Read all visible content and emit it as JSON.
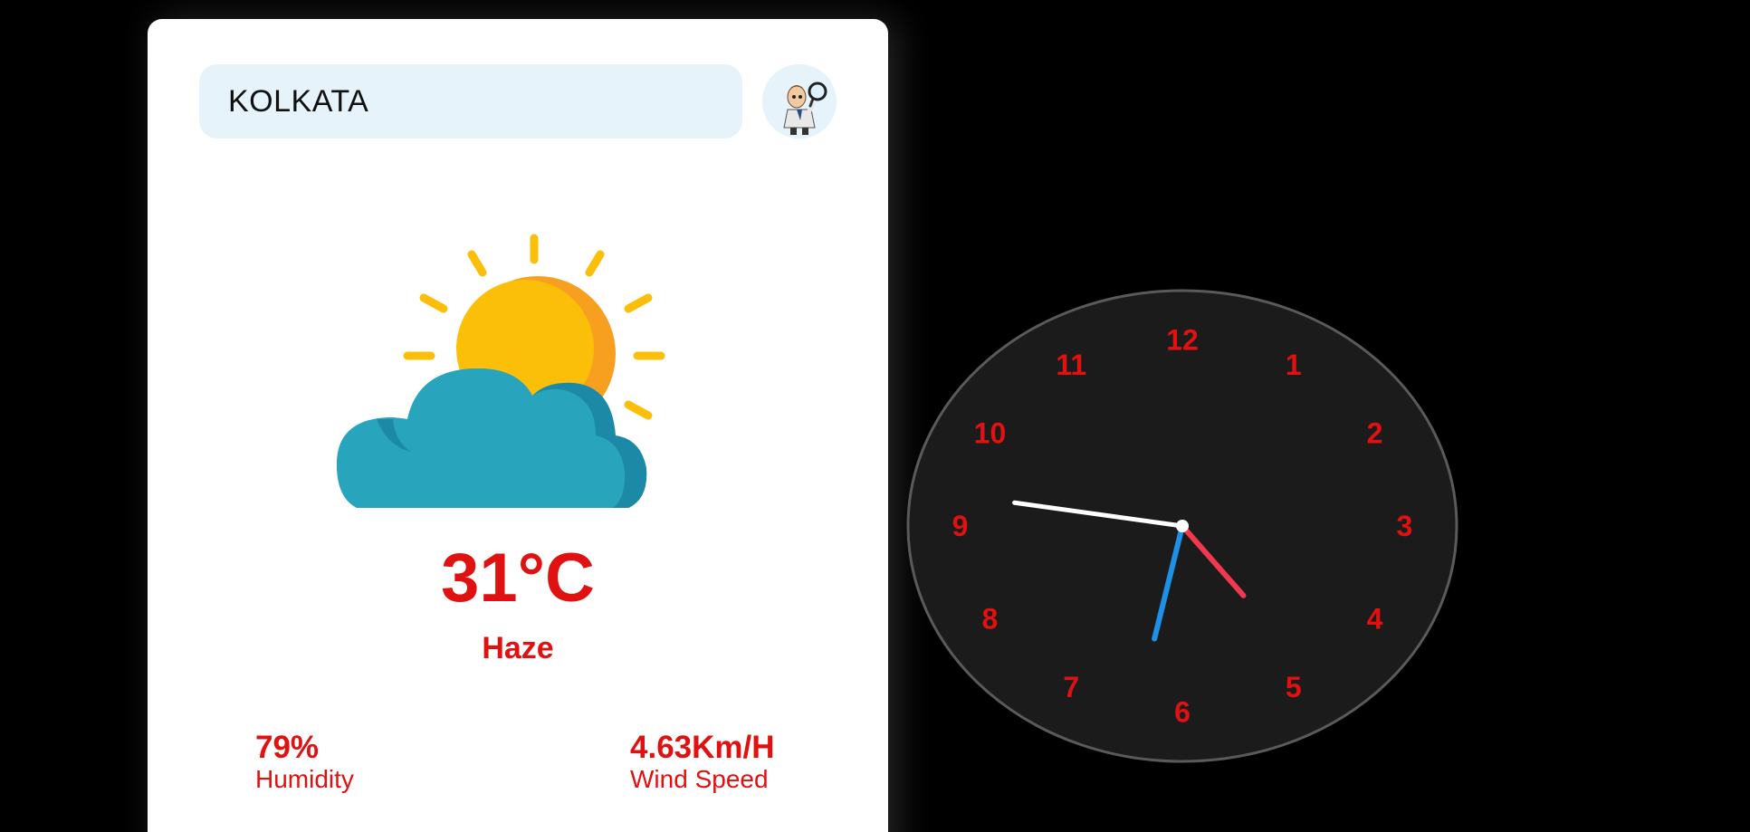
{
  "search": {
    "value": "KOLKATA",
    "button_icon": "detective-magnifier-icon"
  },
  "weather": {
    "icon": "sun-behind-cloud-icon",
    "temperature": "31°C",
    "condition": "Haze",
    "humidity": {
      "value": "79%",
      "label": "Humidity"
    },
    "wind": {
      "value": "4.63Km/H",
      "label": "Wind Speed"
    }
  },
  "clock": {
    "numerals": [
      "12",
      "1",
      "2",
      "3",
      "4",
      "5",
      "6",
      "7",
      "8",
      "9",
      "10",
      "11"
    ],
    "time": {
      "hours": 4,
      "minutes": 46,
      "seconds": 32
    },
    "colors": {
      "face": "#1b1b1b",
      "numerals": "#e01111",
      "hour_hand": "#f0384f",
      "minute_hand": "#ffffff",
      "second_hand": "#1e90e6"
    }
  },
  "colors": {
    "accent": "#e01111",
    "input_bg": "#e6f3fb",
    "sun": "#fbbf0a",
    "sun_shade": "#f7a020",
    "cloud": "#28a4bc",
    "cloud_shade": "#1c8aa6"
  }
}
